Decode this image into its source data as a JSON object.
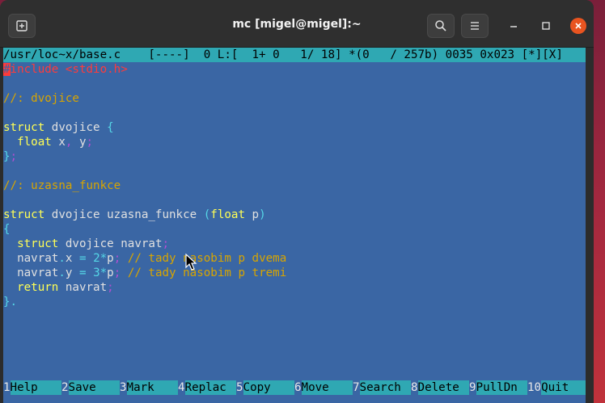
{
  "window": {
    "title": "mc [migel@migel]:~",
    "new_tab_icon": "new-tab-icon",
    "search_icon": "search-icon",
    "menu_icon": "hamburger-menu-icon",
    "minimize_icon": "minimize-icon",
    "maximize_icon": "maximize-icon",
    "close_icon": "close-icon"
  },
  "editor": {
    "status": "/usr/loc~x/base.c    [----]  0 L:[  1+ 0   1/ 18] *(0   / 257b) 0035 0x023 [*][X]",
    "lines": [
      "#include <stdio.h>",
      "",
      "//: dvojice",
      "",
      "struct dvojice {",
      "  float x, y;",
      "};",
      "",
      "//: uzasna_funkce",
      "",
      "struct dvojice uzasna_funkce (float p)",
      "{",
      "  struct dvojice navrat;",
      "  navrat.x = 2*p; // tady nasobim p dvema",
      "  navrat.y = 3*p; // tady nasobim p tremi",
      "  return navrat;",
      "}."
    ]
  },
  "fkeys": [
    {
      "num": "1",
      "label": "Help"
    },
    {
      "num": "2",
      "label": "Save"
    },
    {
      "num": "3",
      "label": "Mark"
    },
    {
      "num": "4",
      "label": "Replac"
    },
    {
      "num": "5",
      "label": "Copy"
    },
    {
      "num": "6",
      "label": "Move"
    },
    {
      "num": "7",
      "label": "Search"
    },
    {
      "num": "8",
      "label": "Delete"
    },
    {
      "num": "9",
      "label": "PullDn"
    },
    {
      "num": "10",
      "label": "Quit"
    }
  ],
  "colors": {
    "editor_bg": "#3a66a4",
    "bar_bg": "#2fa8b3",
    "close_button": "#e95420"
  }
}
